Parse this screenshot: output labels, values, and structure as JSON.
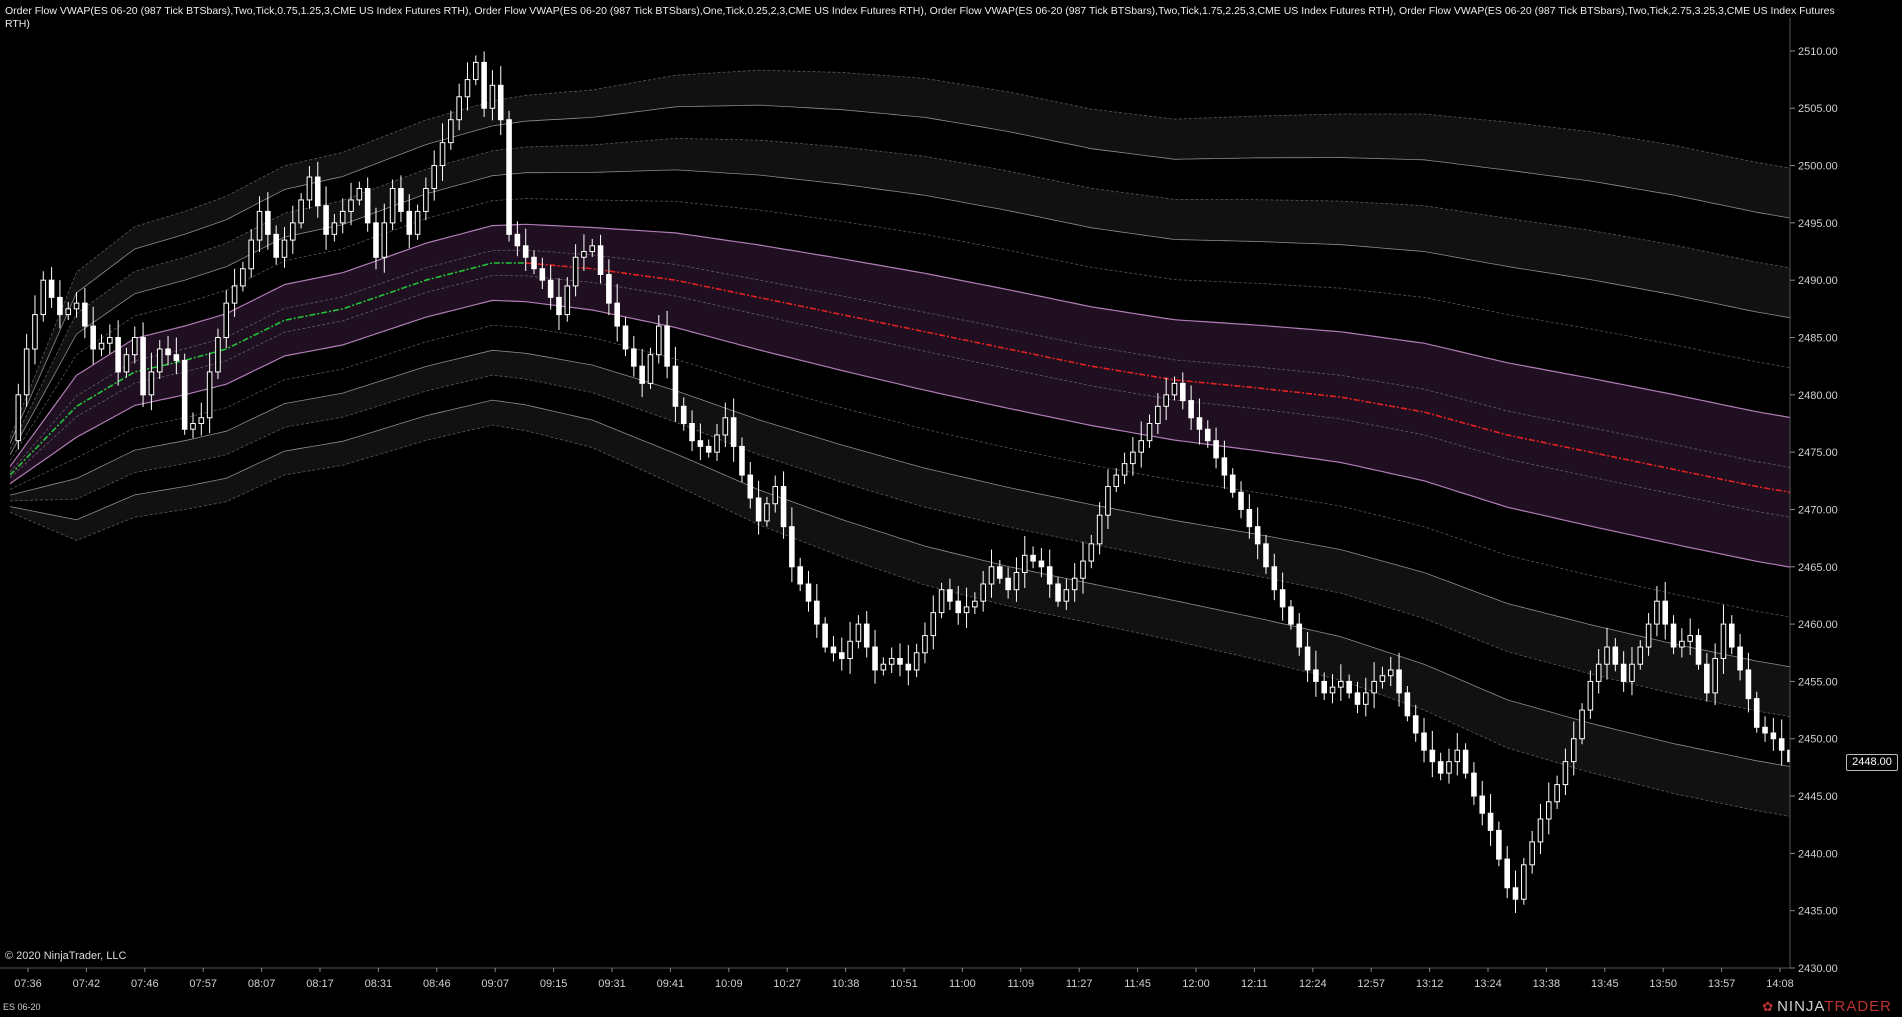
{
  "header": {
    "indicators_text": "Order Flow VWAP(ES 06-20 (987 Tick BTSbars),Two,Tick,0.75,1.25,3,CME US Index Futures RTH), Order Flow VWAP(ES 06-20 (987 Tick BTSbars),One,Tick,0.25,2,3,CME US Index Futures RTH), Order Flow VWAP(ES 06-20 (987 Tick BTSbars),Two,Tick,1.75,2.25,3,CME US Index Futures RTH), Order Flow VWAP(ES 06-20 (987 Tick BTSbars),Two,Tick,2.75,3.25,3,CME US Index Futures RTH)"
  },
  "footer": {
    "copyright": "© 2020 NinjaTrader, LLC",
    "instrument": "ES 06-20",
    "brand_prefix": "NINJA",
    "brand_suffix": "TRADER"
  },
  "last_price_label": "2448.00",
  "colors": {
    "background": "#000000",
    "candles": "#ffffff",
    "vwap_up": "#22c43a",
    "vwap_down": "#e02222",
    "vwap_band_fill": "#1f0f20",
    "vwap_band_line": "#c28ac8",
    "std_band_line": "#9a9a9a",
    "std_band_fill": "#111111",
    "brand_red": "#b33333"
  },
  "chart_data": {
    "type": "candlestick",
    "y_axis": {
      "ylim": [
        2430,
        2512
      ],
      "ticks": [
        "2430.00",
        "2435.00",
        "2440.00",
        "2445.00",
        "2450.00",
        "2455.00",
        "2460.00",
        "2465.00",
        "2470.00",
        "2475.00",
        "2480.00",
        "2485.00",
        "2490.00",
        "2495.00",
        "2500.00",
        "2505.00",
        "2510.00"
      ],
      "position": "right"
    },
    "x_axis": {
      "tick_labels": [
        "07:36",
        "07:42",
        "07:46",
        "07:57",
        "08:07",
        "08:17",
        "08:31",
        "08:46",
        "09:07",
        "09:15",
        "09:31",
        "09:41",
        "10:09",
        "10:27",
        "10:38",
        "10:51",
        "11:00",
        "11:09",
        "11:27",
        "11:45",
        "12:00",
        "12:11",
        "12:24",
        "12:57",
        "13:12",
        "13:24",
        "13:38",
        "13:45",
        "13:50",
        "13:57",
        "14:08"
      ]
    },
    "price_path": [
      [
        0,
        2476
      ],
      [
        2,
        2484
      ],
      [
        4,
        2490
      ],
      [
        6,
        2487
      ],
      [
        8,
        2488
      ],
      [
        10,
        2484
      ],
      [
        12,
        2485
      ],
      [
        13,
        2482
      ],
      [
        15,
        2485
      ],
      [
        16,
        2480
      ],
      [
        18,
        2484
      ],
      [
        20,
        2483
      ],
      [
        21,
        2477
      ],
      [
        23,
        2478
      ],
      [
        24,
        2482
      ],
      [
        26,
        2488
      ],
      [
        28,
        2491
      ],
      [
        30,
        2496
      ],
      [
        32,
        2492
      ],
      [
        34,
        2495
      ],
      [
        36,
        2499
      ],
      [
        38,
        2494
      ],
      [
        40,
        2496
      ],
      [
        42,
        2498
      ],
      [
        44,
        2492
      ],
      [
        46,
        2498
      ],
      [
        48,
        2494
      ],
      [
        50,
        2498
      ],
      [
        52,
        2502
      ],
      [
        54,
        2506
      ],
      [
        56,
        2509
      ],
      [
        57,
        2505
      ],
      [
        58,
        2507
      ],
      [
        59,
        2504
      ],
      [
        60,
        2494
      ],
      [
        62,
        2492
      ],
      [
        64,
        2490
      ],
      [
        66,
        2487
      ],
      [
        68,
        2492
      ],
      [
        70,
        2493
      ],
      [
        72,
        2488
      ],
      [
        74,
        2484
      ],
      [
        76,
        2481
      ],
      [
        78,
        2486
      ],
      [
        80,
        2479
      ],
      [
        82,
        2476
      ],
      [
        84,
        2475
      ],
      [
        86,
        2478
      ],
      [
        88,
        2473
      ],
      [
        90,
        2469
      ],
      [
        92,
        2472
      ],
      [
        94,
        2465
      ],
      [
        96,
        2462
      ],
      [
        98,
        2458
      ],
      [
        100,
        2457
      ],
      [
        102,
        2460
      ],
      [
        104,
        2456
      ],
      [
        106,
        2457
      ],
      [
        108,
        2456
      ],
      [
        110,
        2459
      ],
      [
        112,
        2463
      ],
      [
        114,
        2461
      ],
      [
        116,
        2462
      ],
      [
        118,
        2465
      ],
      [
        120,
        2463
      ],
      [
        122,
        2466
      ],
      [
        124,
        2465
      ],
      [
        126,
        2462
      ],
      [
        128,
        2464
      ],
      [
        130,
        2467
      ],
      [
        132,
        2472
      ],
      [
        134,
        2474
      ],
      [
        136,
        2476
      ],
      [
        138,
        2479
      ],
      [
        140,
        2481
      ],
      [
        142,
        2478
      ],
      [
        144,
        2476
      ],
      [
        146,
        2473
      ],
      [
        148,
        2470
      ],
      [
        150,
        2467
      ],
      [
        152,
        2463
      ],
      [
        154,
        2460
      ],
      [
        156,
        2456
      ],
      [
        158,
        2454
      ],
      [
        160,
        2455
      ],
      [
        162,
        2453
      ],
      [
        164,
        2455
      ],
      [
        166,
        2456
      ],
      [
        168,
        2452
      ],
      [
        170,
        2449
      ],
      [
        172,
        2447
      ],
      [
        174,
        2449
      ],
      [
        176,
        2445
      ],
      [
        178,
        2442
      ],
      [
        180,
        2437
      ],
      [
        181,
        2436
      ],
      [
        182,
        2439
      ],
      [
        184,
        2443
      ],
      [
        186,
        2446
      ],
      [
        188,
        2450
      ],
      [
        190,
        2455
      ],
      [
        192,
        2458
      ],
      [
        194,
        2455
      ],
      [
        196,
        2458
      ],
      [
        198,
        2462
      ],
      [
        200,
        2458
      ],
      [
        202,
        2459
      ],
      [
        204,
        2454
      ],
      [
        206,
        2460
      ],
      [
        208,
        2456
      ],
      [
        210,
        2451
      ],
      [
        212,
        2450
      ],
      [
        214,
        2448
      ]
    ],
    "vwap": [
      [
        0,
        2473
      ],
      [
        8,
        2479
      ],
      [
        15,
        2482
      ],
      [
        21,
        2483
      ],
      [
        26,
        2484
      ],
      [
        33,
        2486.5
      ],
      [
        40,
        2487.5
      ],
      [
        50,
        2490
      ],
      [
        58,
        2491.5
      ],
      [
        62,
        2491.5
      ],
      [
        70,
        2491
      ],
      [
        80,
        2490
      ],
      [
        90,
        2488.5
      ],
      [
        100,
        2487
      ],
      [
        110,
        2485.5
      ],
      [
        120,
        2484
      ],
      [
        130,
        2482.5
      ],
      [
        140,
        2481.3
      ],
      [
        150,
        2480.6
      ],
      [
        160,
        2479.8
      ],
      [
        170,
        2478.5
      ],
      [
        180,
        2476.5
      ],
      [
        190,
        2475
      ],
      [
        200,
        2473.5
      ],
      [
        210,
        2472
      ],
      [
        214,
        2471.5
      ]
    ],
    "vwap_color_split_index": 62,
    "band_multipliers": [
      0.25,
      0.75,
      1.25,
      1.75,
      2.25,
      2.75,
      3.25
    ],
    "sigma": [
      [
        0,
        1
      ],
      [
        8,
        3.6
      ],
      [
        15,
        3.9
      ],
      [
        21,
        4.0
      ],
      [
        26,
        4.1
      ],
      [
        40,
        4.2
      ],
      [
        50,
        4.3
      ],
      [
        58,
        4.35
      ],
      [
        62,
        4.5
      ],
      [
        70,
        4.8
      ],
      [
        80,
        5.5
      ],
      [
        90,
        6.1
      ],
      [
        100,
        6.5
      ],
      [
        110,
        6.8
      ],
      [
        120,
        6.9
      ],
      [
        130,
        6.9
      ],
      [
        140,
        7.0
      ],
      [
        150,
        7.3
      ],
      [
        160,
        7.6
      ],
      [
        170,
        8.0
      ],
      [
        180,
        8.4
      ],
      [
        190,
        8.6
      ],
      [
        200,
        8.7
      ],
      [
        214,
        8.7
      ]
    ],
    "last_price": 2448.0
  }
}
